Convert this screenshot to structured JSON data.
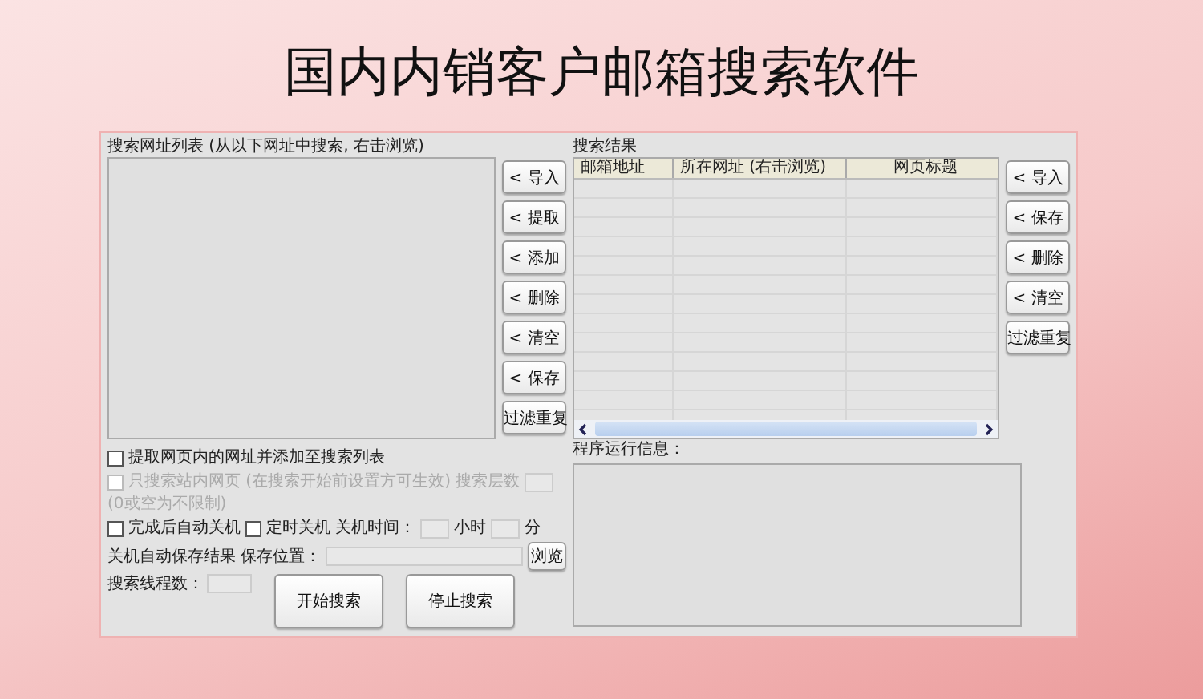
{
  "title": "国内内销客户邮箱搜索软件",
  "url_list": {
    "label": "搜索网址列表 (从以下网址中搜索, 右击浏览)",
    "buttons": [
      "< 导入",
      "< 提取",
      "< 添加",
      "< 删除",
      "< 清空",
      "< 保存",
      "过滤重复"
    ]
  },
  "crawl_option": {
    "label": "提取网页内的网址并添加至搜索列表",
    "checked": false,
    "disabled": false
  },
  "site_only_option": {
    "label": "只搜索站内网页 (在搜索开始前设置方可生效)",
    "checked": false,
    "disabled": true,
    "depth_label": "搜索层数",
    "depth_hint": "(0或空为不限制)"
  },
  "shutdown": {
    "auto": {
      "label": "完成后自动关机",
      "checked": false
    },
    "timed": {
      "label": "定时关机",
      "checked": false
    },
    "time_label": "关机时间：",
    "hour_unit": "小时",
    "minute_unit": "分"
  },
  "save": {
    "label": "关机自动保存结果 保存位置：",
    "browse_button": "浏览"
  },
  "threads_label": "搜索线程数：",
  "action_buttons": [
    "开始搜索",
    "停止搜索"
  ],
  "results": {
    "label": "搜索结果",
    "columns": [
      "邮箱地址",
      "所在网址 (右击浏览)",
      "网页标题"
    ],
    "buttons": [
      "< 导入",
      "< 保存",
      "< 删除",
      "< 清空",
      "过滤重复"
    ]
  },
  "log": {
    "label": "程序运行信息："
  }
}
